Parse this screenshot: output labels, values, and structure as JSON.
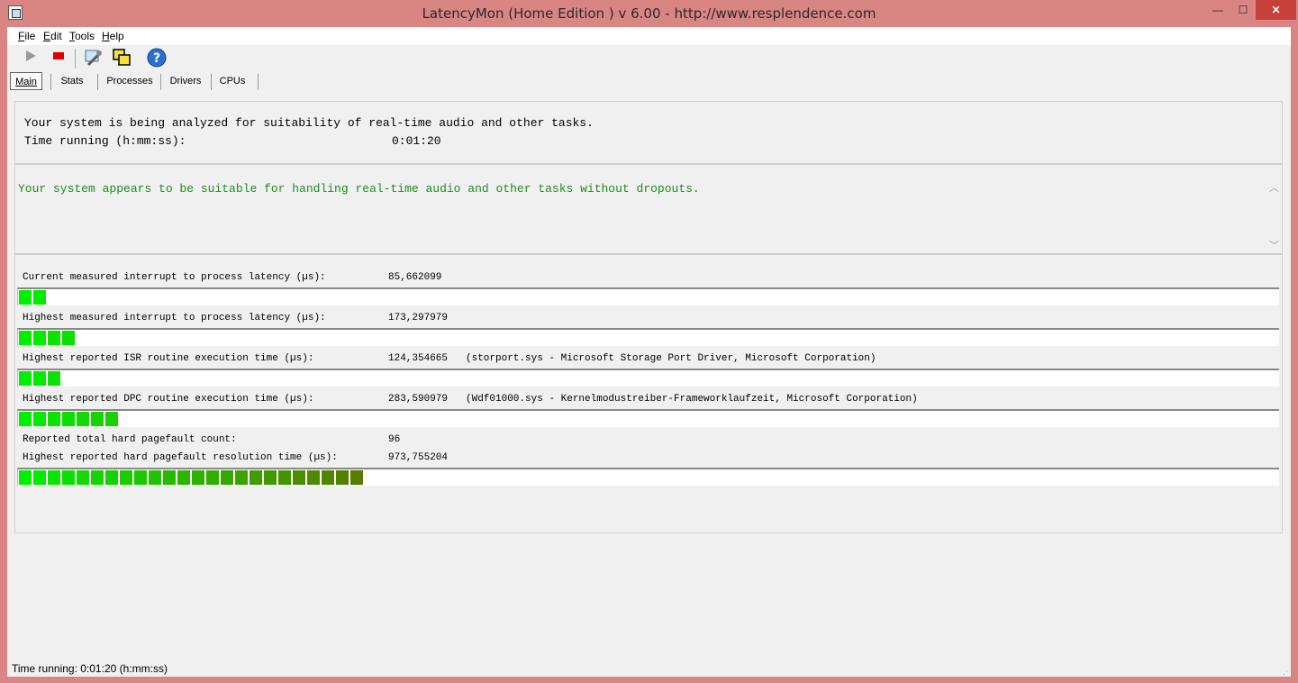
{
  "window": {
    "title": "LatencyMon  (Home Edition )  v 6.00 - http://www.resplendence.com",
    "min_glyph": "—",
    "max_glyph": "☐",
    "close_glyph": "✕"
  },
  "menu": [
    {
      "pre": "",
      "u": "F",
      "post": "ile"
    },
    {
      "pre": "",
      "u": "E",
      "post": "dit"
    },
    {
      "pre": "",
      "u": "T",
      "post": "ools"
    },
    {
      "pre": "",
      "u": "H",
      "post": "elp"
    }
  ],
  "toolbar": {
    "icons": [
      "play-icon",
      "stop-icon",
      "wrench-icon",
      "windows-icon",
      "help-icon"
    ]
  },
  "tabs": [
    {
      "label": "Main",
      "active": true
    },
    {
      "label": "Stats",
      "active": false
    },
    {
      "label": "Processes",
      "active": false
    },
    {
      "label": "Drivers",
      "active": false
    },
    {
      "label": "CPUs",
      "active": false
    }
  ],
  "analysis": {
    "line1": "Your system is being analyzed for suitability of real-time audio and other tasks.",
    "time_label": "Time running (h:mm:ss):",
    "time_value": "0:01:20"
  },
  "verdict": {
    "message": "Your system appears to be suitable for handling real-time audio and other tasks without dropouts."
  },
  "metrics": [
    {
      "label": "Current measured interrupt to process latency (µs):",
      "value": "85,662099",
      "extra": "",
      "bar_cells": 2
    },
    {
      "label": "Highest measured interrupt to process latency (µs):",
      "value": "173,297979",
      "extra": "",
      "bar_cells": 4
    },
    {
      "label": "Highest reported ISR routine execution time (µs):",
      "value": "124,354665",
      "extra": "(storport.sys - Microsoft Storage Port Driver, Microsoft Corporation)",
      "bar_cells": 3
    },
    {
      "label": "Highest reported DPC routine execution time (µs):",
      "value": "283,590979",
      "extra": "(Wdf01000.sys - Kernelmodustreiber-Frameworklaufzeit, Microsoft Corporation)",
      "bar_cells": 7
    },
    {
      "label": "Reported total hard pagefault count:",
      "value": "96",
      "extra": "",
      "bar_cells": null
    },
    {
      "label": "Highest reported hard pagefault resolution time (µs):",
      "value": "973,755204",
      "extra": "",
      "bar_cells": 24
    }
  ],
  "status": {
    "text": "Time running: 0:01:20  (h:mm:ss)"
  },
  "colors": {
    "bar_start": "#00ee00",
    "bar_end": "#5a7a00",
    "verdict_text": "#1a8f1a",
    "titlebar": "#d98583",
    "close_button": "#c7413b"
  }
}
